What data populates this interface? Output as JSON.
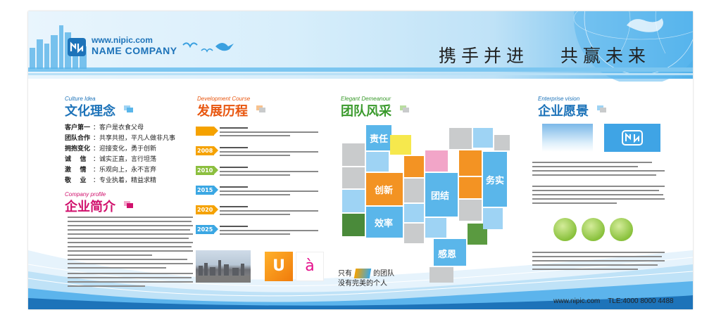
{
  "header": {
    "logo_url": "www.nipic.com",
    "logo_company": "NAME COMPANY",
    "slogan": "携手并进   共赢未来"
  },
  "culture": {
    "en": "Culture Idea",
    "title": "文化理念",
    "rows": [
      {
        "key": "客户第一",
        "sep": "：",
        "value": "客户是衣食父母"
      },
      {
        "key": "团队合作",
        "sep": "：",
        "value": "共享共担，平凡人做非凡事"
      },
      {
        "key": "拥抱变化",
        "sep": "：",
        "value": "迎接变化，勇于创新"
      },
      {
        "key": "诚    信",
        "sep": "：",
        "value": "诚实正直，言行坦荡"
      },
      {
        "key": "激    情",
        "sep": "：",
        "value": "乐观向上，永不言弃"
      },
      {
        "key": "敬    业",
        "sep": "：",
        "value": "专业执着，精益求精"
      }
    ]
  },
  "profile": {
    "en": "Company profile",
    "title": "企业简介"
  },
  "development": {
    "en": "Development Course",
    "title": "发展历程",
    "items": [
      {
        "year": "",
        "color": "#f5a200"
      },
      {
        "year": "2008",
        "color": "#f5a200"
      },
      {
        "year": "2010",
        "color": "#8cbf3f"
      },
      {
        "year": "2015",
        "color": "#3ba7e3"
      },
      {
        "year": "2020",
        "color": "#f5a200"
      },
      {
        "year": "2025",
        "color": "#3ba7e3"
      }
    ],
    "badge_u": "U",
    "badge_a": "à"
  },
  "team": {
    "en": "Elegant Demeanour",
    "title": "团队风采",
    "words": [
      "责任",
      "创新",
      "效率",
      "团结",
      "务实",
      "感恩"
    ],
    "caption_prefix": "只有",
    "caption_suffix": "的团队",
    "caption_line2": "没有完美的个人"
  },
  "vision": {
    "en": "Enterprise vision",
    "title": "企业愿景"
  },
  "footer": {
    "website": "www.nipic.com",
    "tel": "TLE:4000 8000 4488"
  },
  "colors": {
    "blue": "#1d73b9",
    "culture_title": "#1d73b9",
    "profile_title": "#d0106c",
    "dev_title": "#e8560f",
    "team_title": "#3a9a2c",
    "vision_title": "#1d73b9",
    "tile_blue": "#5ab6ea",
    "tile_orange": "#f39323",
    "tile_gray": "#c9cbcc"
  }
}
